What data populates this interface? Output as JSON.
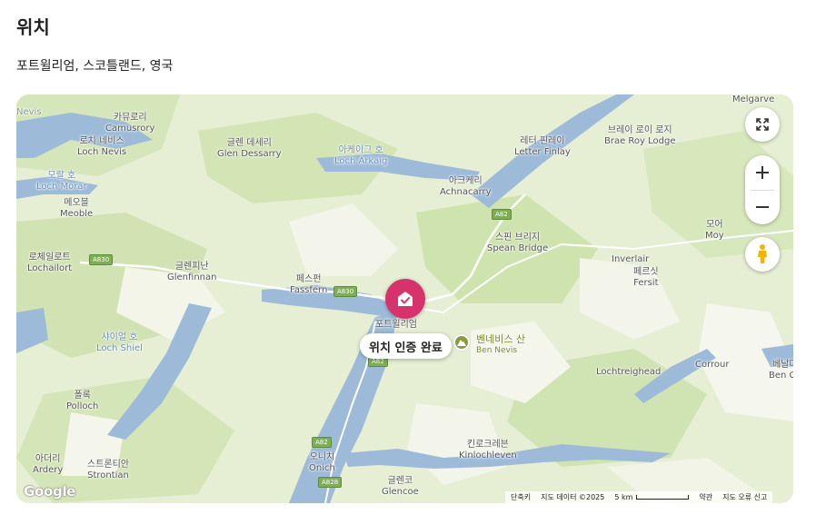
{
  "section": {
    "title": "위치",
    "location": "포트윌리엄, 스코틀랜드, 영국"
  },
  "map": {
    "places": [
      {
        "ko": "카뮤로리",
        "en": "Camusrory"
      },
      {
        "ko": "로치 네비스",
        "en": "Loch Nevis"
      },
      {
        "ko": "글렌 데세리",
        "en": "Glen Dessarry"
      },
      {
        "ko": "아케이그 호",
        "en": "Loch Arkaig"
      },
      {
        "ko": "레터 핀레이",
        "en": "Letter Finlay"
      },
      {
        "ko": "브레이 로이 로지",
        "en": "Brae Roy Lodge"
      },
      {
        "ko": "",
        "en": "Melgarve"
      },
      {
        "ko": "모랄 호",
        "en": "Loch Morar"
      },
      {
        "ko": "메오블",
        "en": "Meoble"
      },
      {
        "ko": "아크케리",
        "en": "Achnacarry"
      },
      {
        "ko": "스핀 브리지",
        "en": "Spean Bridge"
      },
      {
        "ko": "로체일로트",
        "en": "Lochailort"
      },
      {
        "ko": "글렌피난",
        "en": "Glenfinnan"
      },
      {
        "ko": "",
        "en": "Inverlair"
      },
      {
        "ko": "모어",
        "en": "Moy"
      },
      {
        "ko": "페스펀",
        "en": "Fassfern"
      },
      {
        "ko": "페르싯",
        "en": "Fersit"
      },
      {
        "ko": "포트윌리엄",
        "en": ""
      },
      {
        "ko": "샤이얼 호",
        "en": "Loch Shiel"
      },
      {
        "ko": "",
        "en": "Lochtreighead"
      },
      {
        "ko": "",
        "en": "Corrour"
      },
      {
        "ko": "폴록",
        "en": "Polloch"
      },
      {
        "ko": "킨로크레븐",
        "en": "Kinlochleven"
      },
      {
        "ko": "아더리",
        "en": "Ardery"
      },
      {
        "ko": "스트론티안",
        "en": "Strontian"
      },
      {
        "ko": "오니치",
        "en": "Onich"
      },
      {
        "ko": "글렌코",
        "en": "Glencoe"
      },
      {
        "ko": "",
        "en": "Nevis"
      },
      {
        "ko": "베날더",
        "en": "Ben Co"
      }
    ],
    "roads": [
      "A830",
      "A830",
      "A82",
      "A82",
      "A82",
      "A828"
    ],
    "peak": {
      "ko": "벤네비스 산",
      "en": "Ben Nevis"
    },
    "verified_label": "위치 인증 완료",
    "logo": "Google",
    "attribution": {
      "shortcuts": "단축키",
      "map_data": "지도 데이터 ©2025",
      "scale_label": "5 km",
      "terms": "약관",
      "report": "지도 오류 신고"
    },
    "controls": {
      "fullscreen_icon": "fullscreen-icon",
      "zoom_in_icon": "plus-icon",
      "zoom_out_icon": "minus-icon",
      "street_view_icon": "pegman-icon"
    },
    "colors": {
      "pin": "#d6336c",
      "land": "#e9f0d8",
      "forest": "#cfe3b0",
      "water": "#9dbbd9",
      "highland": "#f6f7f0"
    }
  }
}
